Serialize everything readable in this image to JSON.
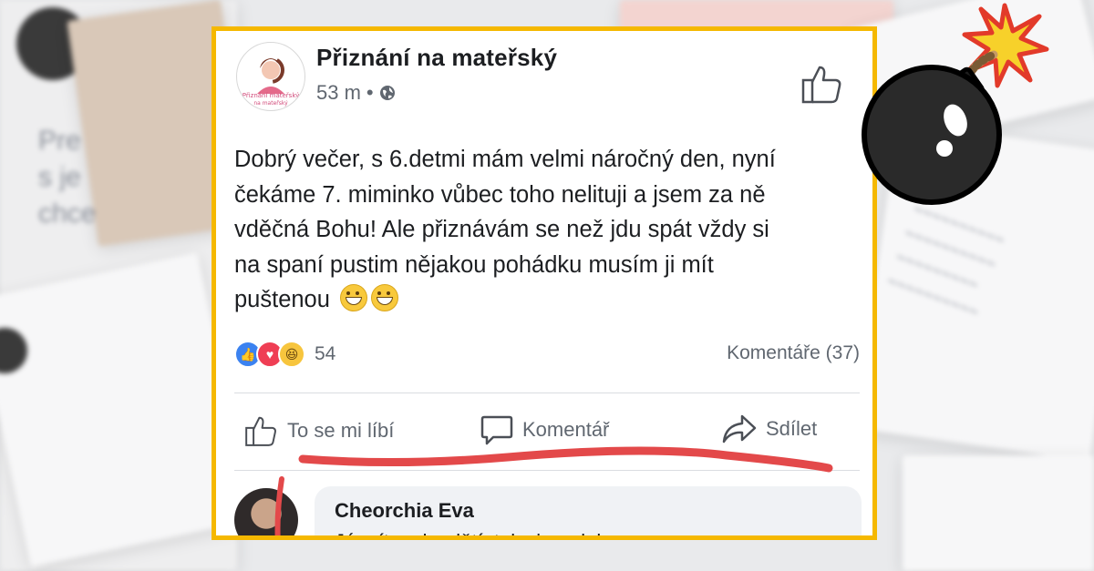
{
  "post": {
    "page_name": "Přiznání na mateřský",
    "avatar_text_1": "Přiznání mateřský",
    "avatar_text_2": "na mateřský",
    "time": "53 m",
    "separator": "•",
    "body_lines": [
      "Dobrý večer, s 6.detmi mám velmi náročný den, nyní",
      "čekáme 7. miminko vůbec toho nelituji a jsem za ně",
      "vděčná Bohu! Ale přiznávám se než jdu spát vždy si",
      "na spaní pustim nějakou pohádku musím ji mít",
      "puštenou"
    ],
    "reaction_count": "54",
    "comments_label": "Komentáře (37)",
    "actions": {
      "like": "To se mi líbí",
      "comment": "Komentář",
      "share": "Sdílet"
    }
  },
  "comment": {
    "author": "Cheorchia Eva",
    "text": "Já mít sedm dětí, tak si na dobrou noc"
  },
  "colors": {
    "frame": "#f5b800",
    "annotation_stroke": "#e3494a",
    "like_blue": "#3b82f0",
    "love_red": "#ef3e54",
    "haha_yellow": "#f7c53d"
  },
  "icons": [
    "thumbs-up-icon",
    "globe-icon",
    "comment-icon",
    "share-icon",
    "bomb-icon"
  ]
}
